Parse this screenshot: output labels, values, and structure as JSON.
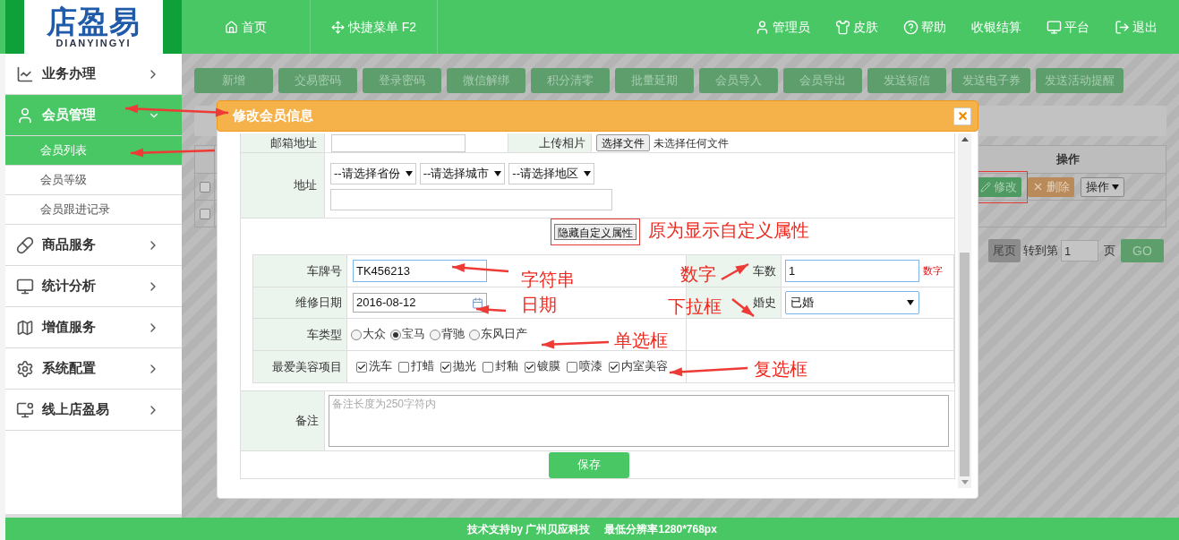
{
  "header": {
    "logo": {
      "main": "店盈易",
      "sub": "DIANYINGYI"
    },
    "nav_left": [
      {
        "label": "首页"
      },
      {
        "label": "快捷菜单 F2"
      }
    ],
    "nav_right": [
      {
        "label": "管理员"
      },
      {
        "label": "皮肤"
      },
      {
        "label": "帮助"
      },
      {
        "label": "收银结算"
      },
      {
        "label": "平台"
      },
      {
        "label": "退出"
      }
    ]
  },
  "sidebar": {
    "items": [
      {
        "label": "业务办理",
        "selected": false,
        "expanded": false
      },
      {
        "label": "会员管理",
        "selected": true,
        "expanded": true,
        "children": [
          {
            "label": "会员列表",
            "selected": true
          },
          {
            "label": "会员等级",
            "selected": false
          },
          {
            "label": "会员跟进记录",
            "selected": false
          }
        ]
      },
      {
        "label": "商品服务",
        "selected": false,
        "expanded": false
      },
      {
        "label": "统计分析",
        "selected": false,
        "expanded": false
      },
      {
        "label": "增值服务",
        "selected": false,
        "expanded": false
      },
      {
        "label": "系统配置",
        "selected": false,
        "expanded": false
      },
      {
        "label": "线上店盈易",
        "selected": false,
        "expanded": false
      }
    ]
  },
  "toolbar": [
    "新增",
    "交易密码",
    "登录密码",
    "微信解绑",
    "积分清零",
    "批量延期",
    "会员导入",
    "会员导出",
    "发送短信",
    "发送电子券",
    "发送活动提醒"
  ],
  "table": {
    "action_column": "操作",
    "rows": [
      {
        "checked": false,
        "actions": [
          {
            "kind": "edit",
            "label": "修改",
            "annotated": true
          },
          {
            "kind": "delete",
            "label": "删除",
            "annotated": false
          },
          {
            "kind": "dropdown",
            "label": "操作",
            "annotated": false
          }
        ]
      },
      {
        "checked": false,
        "actions": []
      }
    ]
  },
  "pagination": {
    "last": "尾页",
    "goto": "转到第",
    "page": "1",
    "unit": "页",
    "go": "GO"
  },
  "modal": {
    "title": "修改会员信息",
    "email": {
      "label": "邮箱地址",
      "upload_label": "上传相片",
      "file_button": "选择文件",
      "file_status": "未选择任何文件"
    },
    "address": {
      "label": "地址",
      "selects": [
        "--请选择省份",
        "--请选择城市",
        "--请选择地区"
      ]
    },
    "toggle_button": "隐藏自定义属性",
    "custom_rows": [
      [
        {
          "kind": "text",
          "label": "车牌号",
          "value": "TK456213"
        },
        {
          "kind": "number",
          "label": "车数",
          "value": "1",
          "hint": "数字"
        }
      ],
      [
        {
          "kind": "date",
          "label": "维修日期",
          "value": "2016-08-12"
        },
        {
          "kind": "select",
          "label": "婚史",
          "value": "已婚"
        }
      ],
      [
        {
          "kind": "radio",
          "label": "车类型",
          "options": [
            {
              "label": "大众",
              "selected": false
            },
            {
              "label": "宝马",
              "selected": true
            },
            {
              "label": "背驰",
              "selected": false
            },
            {
              "label": "东风日产",
              "selected": false
            }
          ]
        }
      ],
      [
        {
          "kind": "checkbox",
          "label": "最爱美容项目",
          "options": [
            {
              "label": "洗车",
              "checked": true
            },
            {
              "label": "打蜡",
              "checked": false
            },
            {
              "label": "抛光",
              "checked": true
            },
            {
              "label": "封釉",
              "checked": false
            },
            {
              "label": "镀膜",
              "checked": true
            },
            {
              "label": "喷漆",
              "checked": false
            },
            {
              "label": "内室美容",
              "checked": true
            }
          ]
        }
      ]
    ],
    "remarks": {
      "label": "备注",
      "placeholder": "备注长度为250字符内"
    },
    "save": "保存"
  },
  "annotations": [
    "原为显示自定义属性",
    "字符串",
    "日期",
    "数字",
    "下拉框",
    "单选框",
    "复选框"
  ],
  "footer": {
    "support": "技术支持by 广州贝应科技",
    "resolution": "最低分辨率1280*768px"
  }
}
